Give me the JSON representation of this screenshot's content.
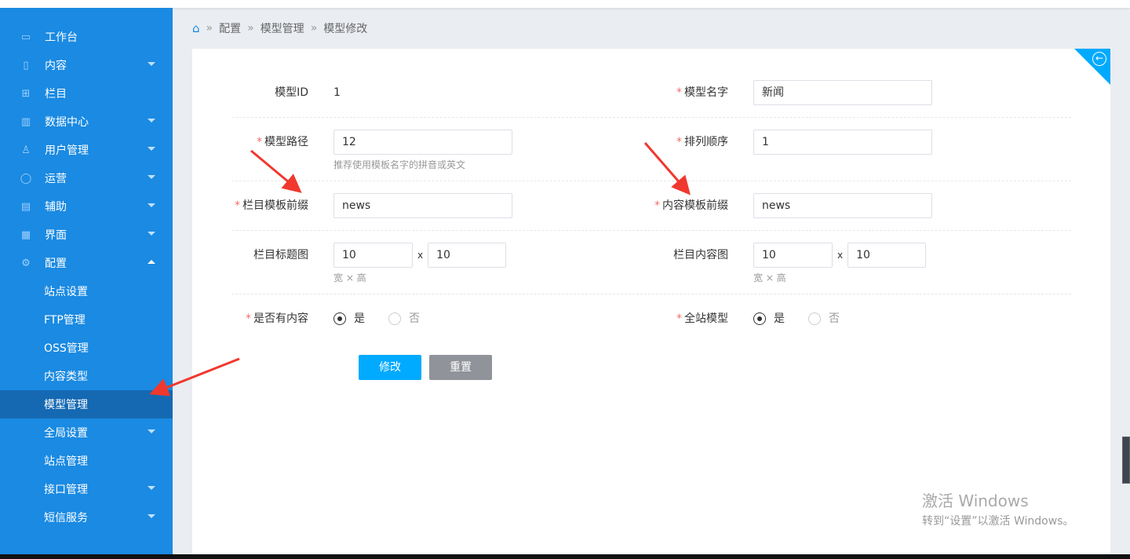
{
  "sidebar": {
    "items": [
      {
        "label": "工作台",
        "icon": "monitor-icon",
        "glyph": "▭",
        "arrow": false
      },
      {
        "label": "内容",
        "icon": "file-icon",
        "glyph": "▯",
        "arrow": true
      },
      {
        "label": "栏目",
        "icon": "grid-icon",
        "glyph": "⊞",
        "arrow": false
      },
      {
        "label": "数据中心",
        "icon": "bar-chart-icon",
        "glyph": "▥",
        "arrow": true
      },
      {
        "label": "用户管理",
        "icon": "user-icon",
        "glyph": "♙",
        "arrow": true
      },
      {
        "label": "运营",
        "icon": "shield-icon",
        "glyph": "◯",
        "arrow": true
      },
      {
        "label": "辅助",
        "icon": "box-icon",
        "glyph": "▤",
        "arrow": true
      },
      {
        "label": "界面",
        "icon": "layout-icon",
        "glyph": "▦",
        "arrow": true
      },
      {
        "label": "配置",
        "icon": "gear-icon",
        "glyph": "⚙",
        "arrow": "up"
      }
    ],
    "sub_items": [
      "站点设置",
      "FTP管理",
      "OSS管理",
      "内容类型",
      "模型管理"
    ],
    "items_after": [
      {
        "label": "全局设置",
        "arrow": true
      },
      {
        "label": "站点管理",
        "arrow": false
      },
      {
        "label": "接口管理",
        "arrow": true
      },
      {
        "label": "短信服务",
        "arrow": true
      }
    ]
  },
  "breadcrumb": [
    "配置",
    "模型管理",
    "模型修改"
  ],
  "form": {
    "model_id_label": "模型ID",
    "model_id": "1",
    "model_name_label": "模型名字",
    "model_name": "新闻",
    "model_path_label": "模型路径",
    "model_path": "12",
    "model_path_hint": "推荐使用模板名字的拼音或英文",
    "sort_label": "排列顺序",
    "sort": "1",
    "channel_prefix_label": "栏目模板前缀",
    "channel_prefix": "news",
    "content_prefix_label": "内容模板前缀",
    "content_prefix": "news",
    "channel_img_label": "栏目标题图",
    "channel_img_w": "10",
    "channel_img_h": "10",
    "content_img_label": "栏目内容图",
    "content_img_w": "10",
    "content_img_h": "10",
    "times": "x",
    "size_hint": "宽 × 高",
    "has_content_label": "是否有内容",
    "global_model_label": "全站模型",
    "yes": "是",
    "no": "否",
    "has_content": "是",
    "global_model": "是",
    "submit": "修改",
    "reset": "重置",
    "required_mark": "*"
  },
  "watermark": {
    "title": "激活 Windows",
    "subtitle": "转到“设置”以激活 Windows。"
  },
  "colors": {
    "sidebar": "#1a8ae2",
    "active": "#1569b3",
    "primary": "#00aaff",
    "reset": "#909399",
    "annotation": "#f0382e"
  }
}
